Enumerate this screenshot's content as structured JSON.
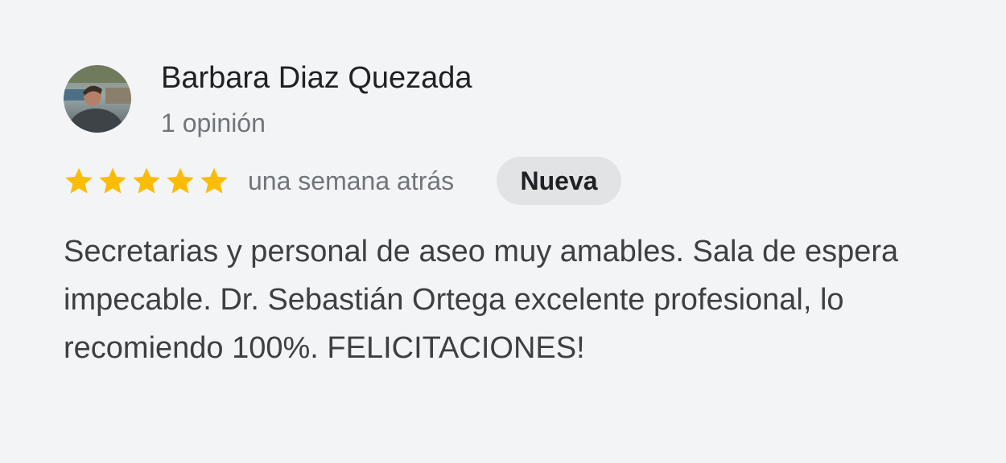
{
  "review": {
    "author": {
      "name": "Barbara Diaz Quezada",
      "review_count": "1 opinión",
      "avatar": "profile-photo"
    },
    "rating": {
      "stars": 5,
      "max": 5,
      "star_icon": "star-icon",
      "star_color": "#fbbc04"
    },
    "date": "una semana atrás",
    "badge": "Nueva",
    "text": "Secretarias y personal de aseo muy amables. Sala de espera impecable. Dr. Sebastián Ortega excelente profesional, lo recomiendo 100%. FELICITACIONES!"
  }
}
